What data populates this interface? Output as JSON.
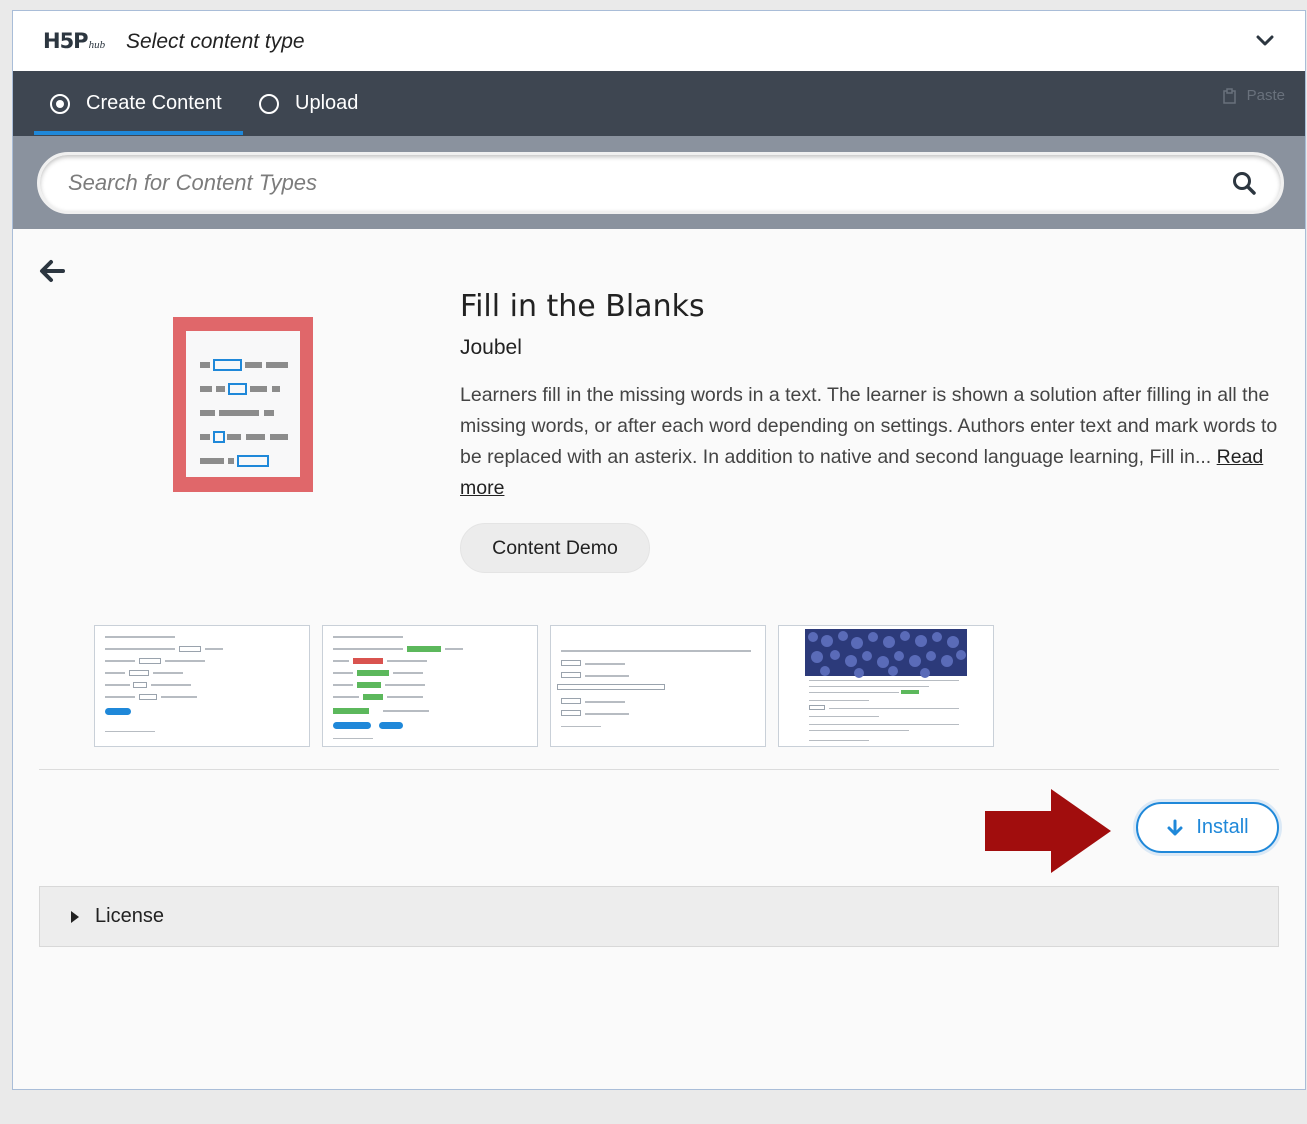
{
  "header": {
    "logo_main": "H5P",
    "logo_sub": "hub",
    "title": "Select content type"
  },
  "tabs": [
    {
      "label": "Create Content",
      "selected": true
    },
    {
      "label": "Upload",
      "selected": false
    }
  ],
  "paste_label": "Paste",
  "search": {
    "placeholder": "Search for Content Types",
    "value": ""
  },
  "detail": {
    "title": "Fill in the Blanks",
    "owner": "Joubel",
    "description": "Learners fill in the missing words in a text. The learner is shown a solution after filling in all the missing words, or after each word depending on settings. Authors enter text and mark words to be replaced with an asterix. In addition to native and second language learning, Fill in...",
    "read_more": "Read more",
    "demo_label": "Content Demo",
    "install_label": "Install",
    "license_label": "License"
  },
  "screenshots": [
    "screenshot-1",
    "screenshot-2",
    "screenshot-3",
    "screenshot-4"
  ],
  "colors": {
    "accent": "#1f88d9",
    "tabbar": "#3e4651",
    "searchband": "#8a929e",
    "icon_red": "#e0676a",
    "annotation_arrow": "#a10d0d"
  },
  "icons": [
    "chevron-down-icon",
    "radio-checked-icon",
    "radio-unchecked-icon",
    "paste-icon",
    "search-icon",
    "back-arrow-icon",
    "download-icon",
    "caret-right-icon"
  ]
}
